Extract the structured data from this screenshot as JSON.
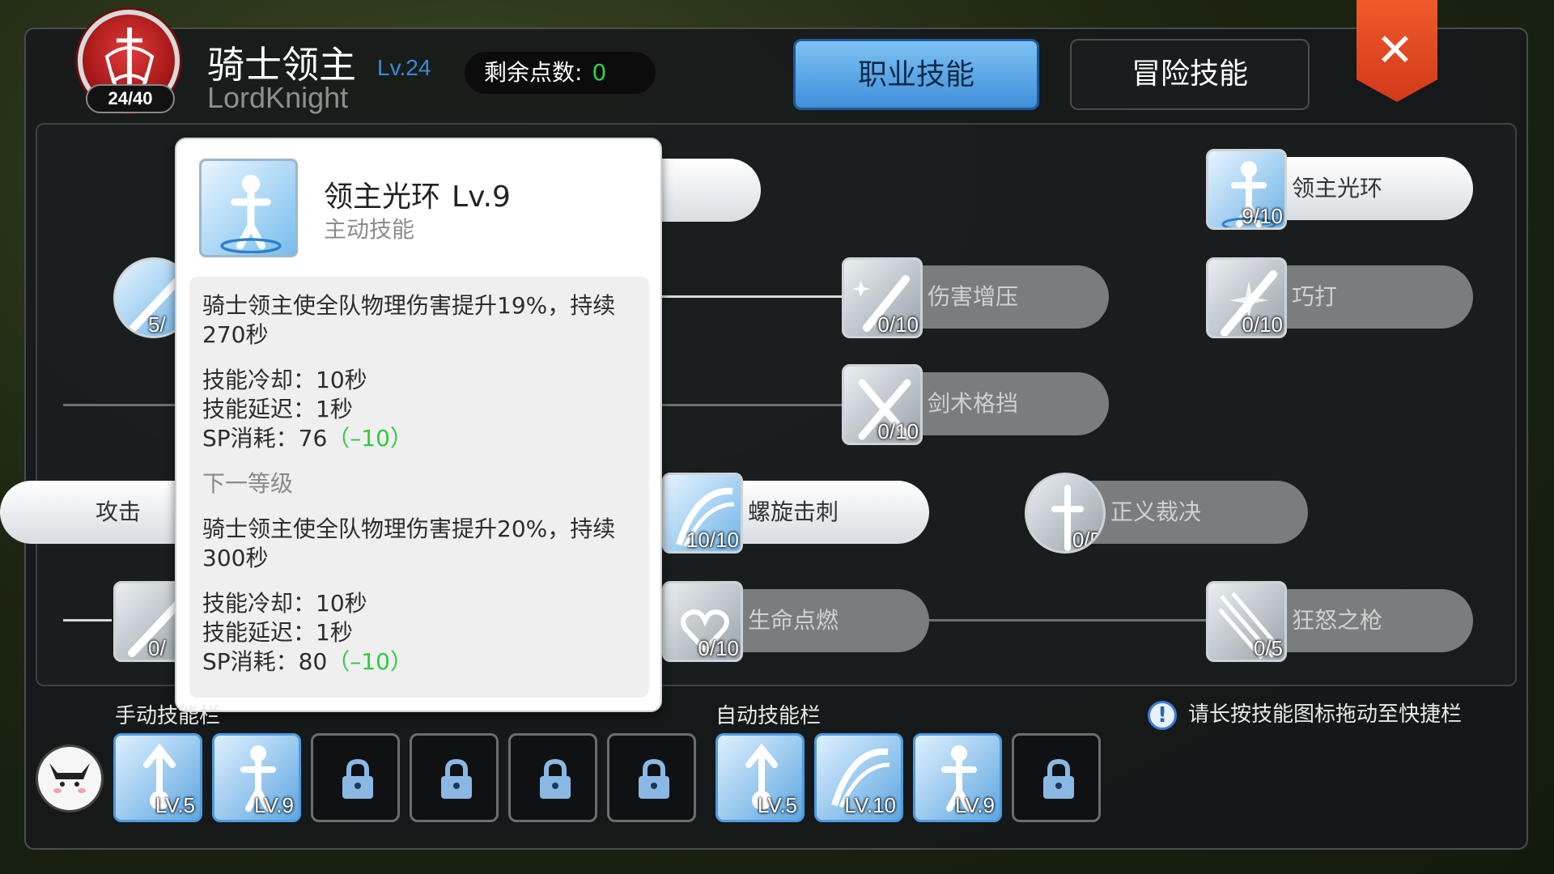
{
  "header": {
    "emblem_count": "24/40",
    "job_name": "骑士领主",
    "job_level": "Lv.24",
    "job_name_en": "LordKnight",
    "points_label": "剩余点数:",
    "points_value": "0",
    "tabs": [
      {
        "label": "职业技能",
        "active": true
      },
      {
        "label": "冒险技能",
        "active": false
      }
    ],
    "close_icon": "close-icon"
  },
  "skills": [
    {
      "name": "领主光环",
      "level": "9/10",
      "icon": "person-aura-icon",
      "state": "active"
    },
    {
      "name": "伤害增压",
      "level": "0/10",
      "icon": "sword-sparkle-icon",
      "state": "dim"
    },
    {
      "name": "巧打",
      "level": "0/10",
      "icon": "sword-burst-icon",
      "state": "dim"
    },
    {
      "name": "剑术格挡",
      "level": "0/10",
      "icon": "crossed-swords-icon",
      "state": "dim"
    },
    {
      "name": "螺旋击刺",
      "level": "10/10",
      "icon": "spiral-pierce-icon",
      "state": "active"
    },
    {
      "name": "正义裁决",
      "level": "0/5",
      "icon": "holy-sword-icon",
      "state": "dim"
    },
    {
      "name": "生命点燃",
      "level": "0/10",
      "icon": "flame-heart-icon",
      "state": "dim"
    },
    {
      "name": "狂怒之枪",
      "level": "0/5",
      "icon": "spear-rays-icon",
      "state": "dim"
    },
    {
      "name": "攻击",
      "level": "",
      "icon": "",
      "state": "active"
    },
    {
      "name": "",
      "level": "5/",
      "icon": "lance-icon",
      "state": "active"
    },
    {
      "name": "",
      "level": "0/",
      "icon": "sword-icon",
      "state": "dim"
    }
  ],
  "tooltip": {
    "title": "领主光环",
    "level": "Lv.9",
    "type": "主动技能",
    "desc": "骑士领主使全队物理伤害提升19%，持续270秒",
    "cooldown": "技能冷却：10秒",
    "delay": "技能延迟：1秒",
    "sp_label": "SP消耗：76",
    "sp_delta": "（–10）",
    "next_label": "下一等级",
    "next_desc": "骑士领主使全队物理伤害提升20%，持续300秒",
    "next_cooldown": "技能冷却：10秒",
    "next_delay": "技能延迟：1秒",
    "next_sp_label": "SP消耗：80",
    "next_sp_delta": "（–10）"
  },
  "bottom": {
    "manual_label": "手动技能栏",
    "auto_label": "自动技能栏",
    "hint": "请长按技能图标拖动至快捷栏",
    "manual_slots": [
      {
        "icon": "lance-icon",
        "level": "LV.5"
      },
      {
        "icon": "person-aura-icon",
        "level": "LV.9"
      },
      {
        "icon": "lock-icon",
        "level": ""
      },
      {
        "icon": "lock-icon",
        "level": ""
      },
      {
        "icon": "lock-icon",
        "level": ""
      },
      {
        "icon": "lock-icon",
        "level": ""
      }
    ],
    "auto_slots": [
      {
        "icon": "lance-icon",
        "level": "LV.5"
      },
      {
        "icon": "spiral-pierce-icon",
        "level": "LV.10"
      },
      {
        "icon": "person-aura-icon",
        "level": "LV.9"
      },
      {
        "icon": "lock-icon",
        "level": ""
      }
    ]
  },
  "colors": {
    "accent_blue": "#3f8fd9",
    "green": "#2ecc40",
    "close_red": "#e0461f"
  }
}
